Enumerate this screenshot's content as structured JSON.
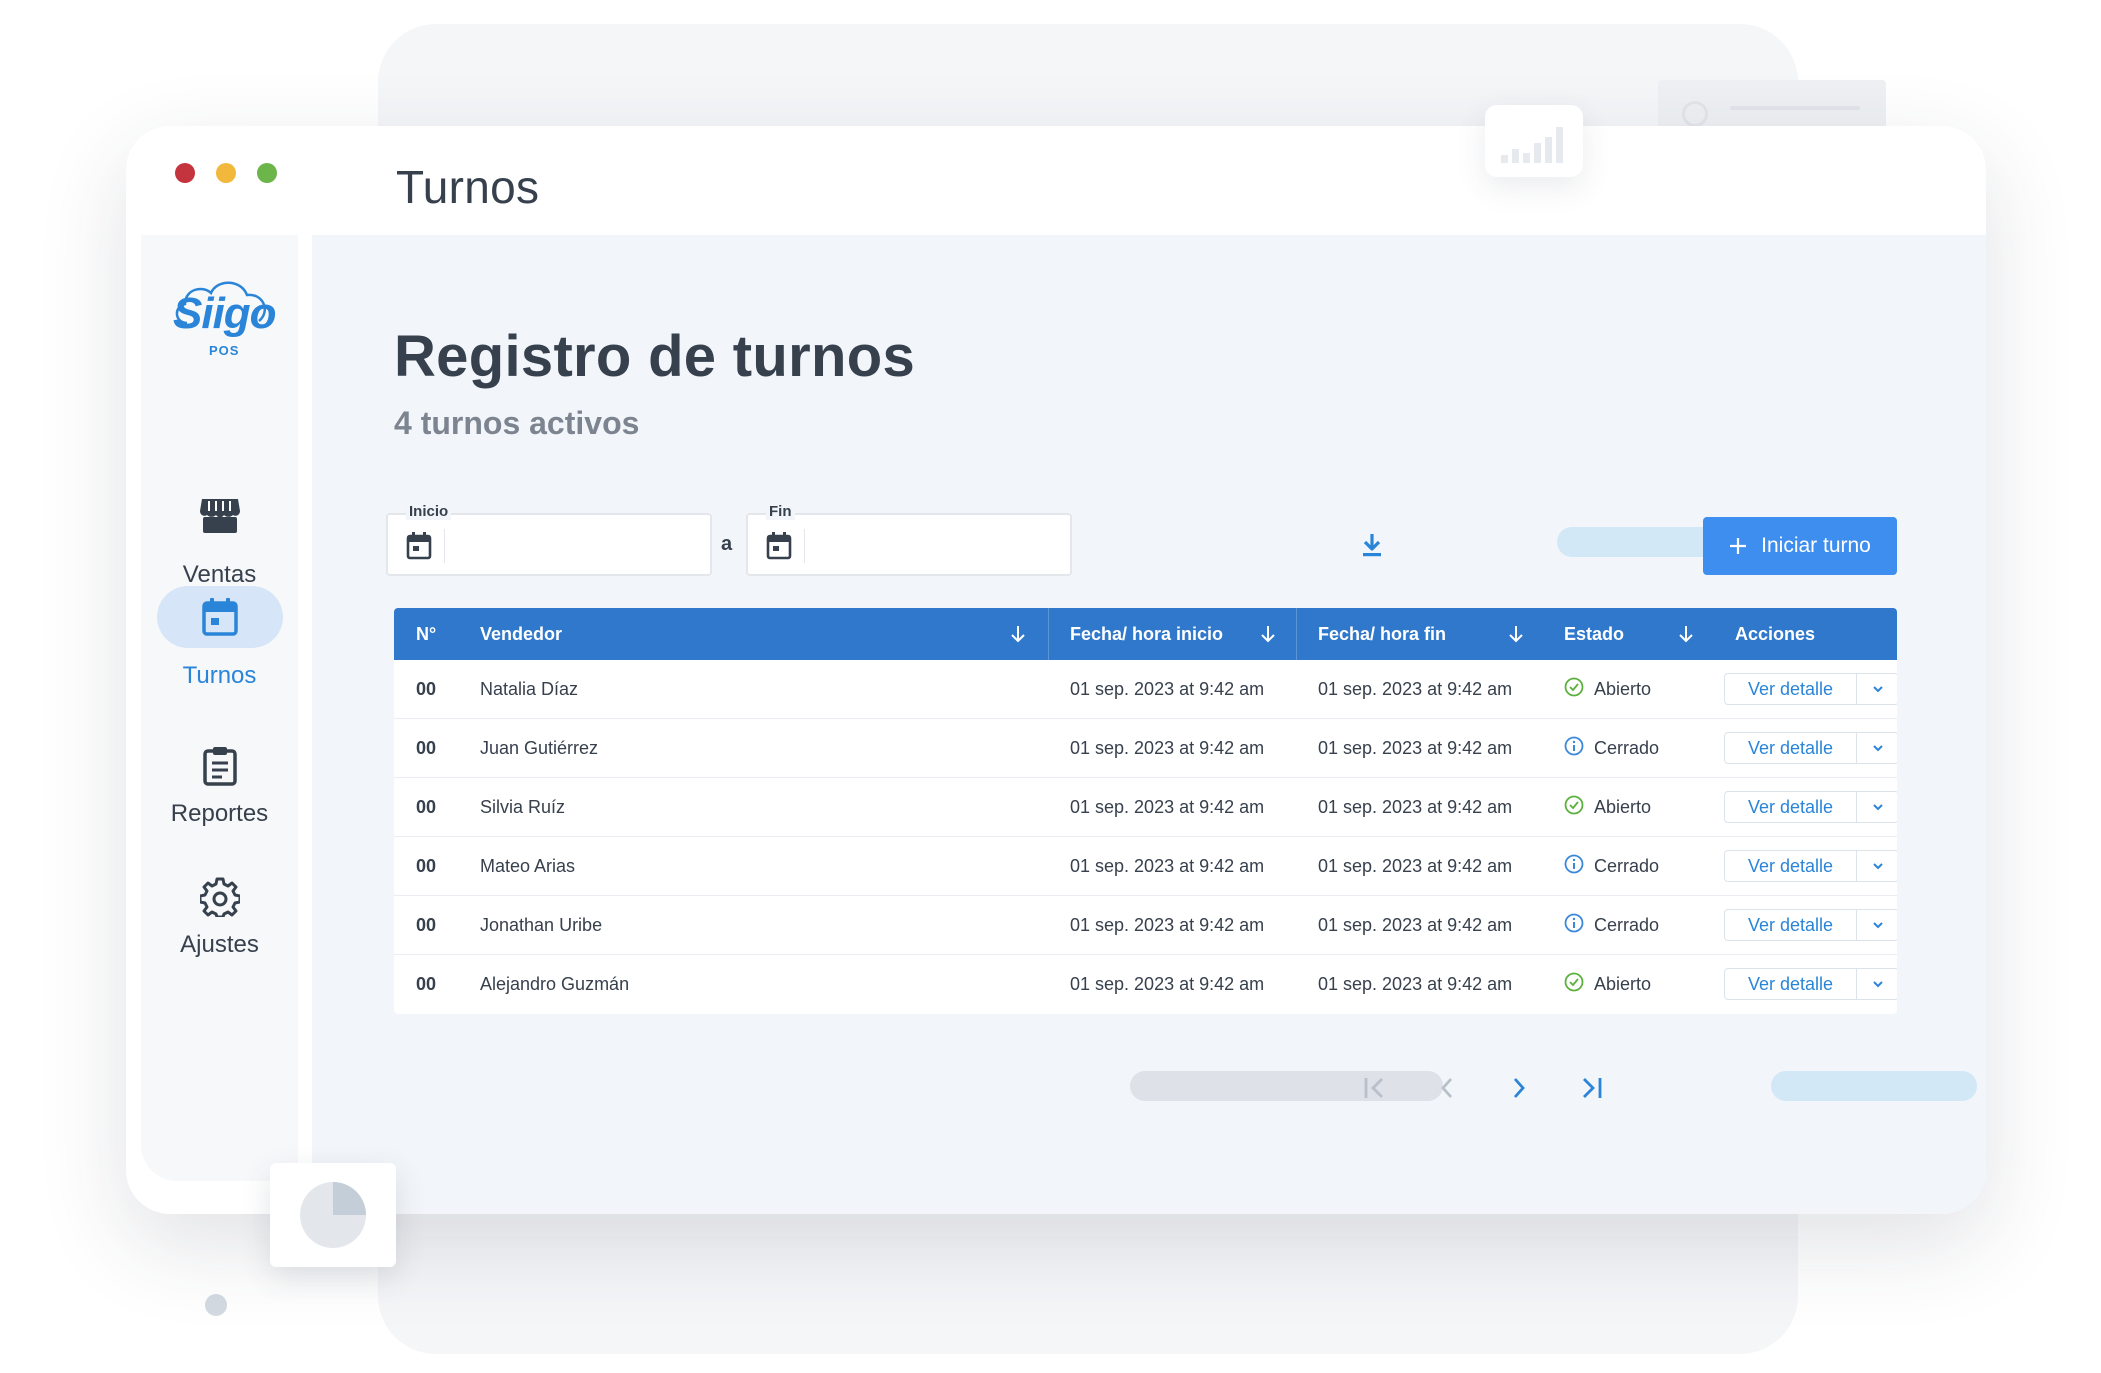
{
  "window": {
    "title": "Turnos"
  },
  "brand": {
    "logo_text": "Siigo",
    "logo_sub": "POS"
  },
  "sidebar": {
    "items": [
      {
        "label": "Ventas",
        "icon": "store-icon",
        "active": false
      },
      {
        "label": "Turnos",
        "icon": "calendar-icon",
        "active": true
      },
      {
        "label": "Reportes",
        "icon": "clipboard-icon",
        "active": false
      },
      {
        "label": "Ajustes",
        "icon": "gear-icon",
        "active": false
      }
    ]
  },
  "page": {
    "title": "Registro de turnos",
    "subtitle": "4 turnos activos"
  },
  "filters": {
    "start_label": "Inicio",
    "start_value": "",
    "range_separator": "a",
    "end_label": "Fin",
    "end_value": ""
  },
  "toolbar": {
    "start_button": "Iniciar turno"
  },
  "table": {
    "headers": {
      "number": "N°",
      "seller": "Vendedor",
      "start": "Fecha/ hora inicio",
      "end": "Fecha/ hora fin",
      "state": "Estado",
      "actions": "Acciones"
    },
    "action_label": "Ver detalle",
    "rows": [
      {
        "num": "00",
        "seller": "Natalia Díaz",
        "start": "01 sep. 2023 at 9:42 am",
        "end": "01 sep. 2023 at 9:42 am",
        "state": "Abierto",
        "state_kind": "open"
      },
      {
        "num": "00",
        "seller": "Juan Gutiérrez",
        "start": "01 sep. 2023 at 9:42 am",
        "end": "01 sep. 2023 at 9:42 am",
        "state": "Cerrado",
        "state_kind": "closed"
      },
      {
        "num": "00",
        "seller": "Silvia Ruíz",
        "start": "01 sep. 2023 at 9:42 am",
        "end": "01 sep. 2023 at 9:42 am",
        "state": "Abierto",
        "state_kind": "open"
      },
      {
        "num": "00",
        "seller": "Mateo Arias",
        "start": "01 sep. 2023 at 9:42 am",
        "end": "01 sep. 2023 at 9:42 am",
        "state": "Cerrado",
        "state_kind": "closed"
      },
      {
        "num": "00",
        "seller": "Jonathan Uribe",
        "start": "01 sep. 2023 at 9:42 am",
        "end": "01 sep. 2023 at 9:42 am",
        "state": "Cerrado",
        "state_kind": "closed"
      },
      {
        "num": "00",
        "seller": "Alejandro Guzmán",
        "start": "01 sep. 2023 at 9:42 am",
        "end": "01 sep. 2023 at 9:42 am",
        "state": "Abierto",
        "state_kind": "open"
      }
    ]
  },
  "colors": {
    "brand_blue": "#2a85d8",
    "header_blue": "#2f78cc",
    "button_blue": "#3e8ef0",
    "open_green": "#5cb03c",
    "closed_blue": "#3b88d9",
    "close_dot": "#c4343f",
    "minimize_dot": "#f2b83b",
    "maximize_dot": "#6cb54b"
  }
}
